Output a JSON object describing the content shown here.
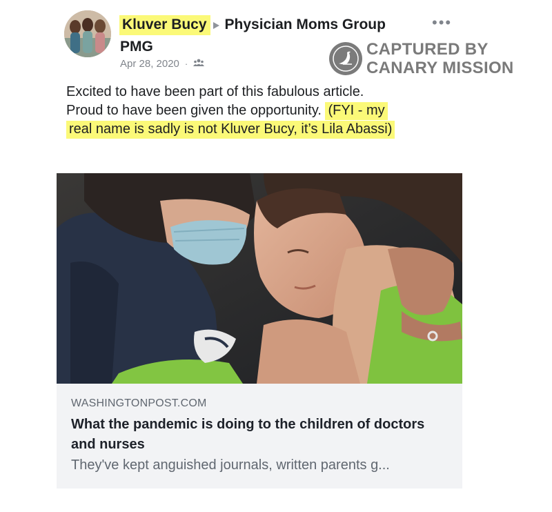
{
  "post": {
    "author_name": "Kluver Bucy",
    "group_name_line1": "Physician Moms Group",
    "group_name_line2": "PMG",
    "date": "Apr 28, 2020",
    "separator": "·",
    "privacy_icon": "group-members-icon",
    "more_icon": "more-options-icon",
    "more_glyph": "•••",
    "text_line1": "Excited to have been part of this fabulous article.",
    "text_line2_plain": "Proud to have been given the opportunity. ",
    "text_line2_highlight": "(FYI - my",
    "text_line3_highlight": "real name is sadly is not Kluver Bucy, it’s Lila Abassi)"
  },
  "watermark": {
    "line1": "CAPTURED BY",
    "line2": "CANARY MISSION",
    "icon": "canary-bird-icon"
  },
  "link_preview": {
    "domain": "WASHINGTONPOST.COM",
    "title": "What the pandemic is doing to the children of doctors and nurses",
    "description": "They've kept anguished journals, written parents g..."
  },
  "colors": {
    "highlight": "#fbf978",
    "card_background": "#f2f3f5",
    "watermark_gray": "#7a7a7a",
    "meta_gray": "#80858c"
  }
}
